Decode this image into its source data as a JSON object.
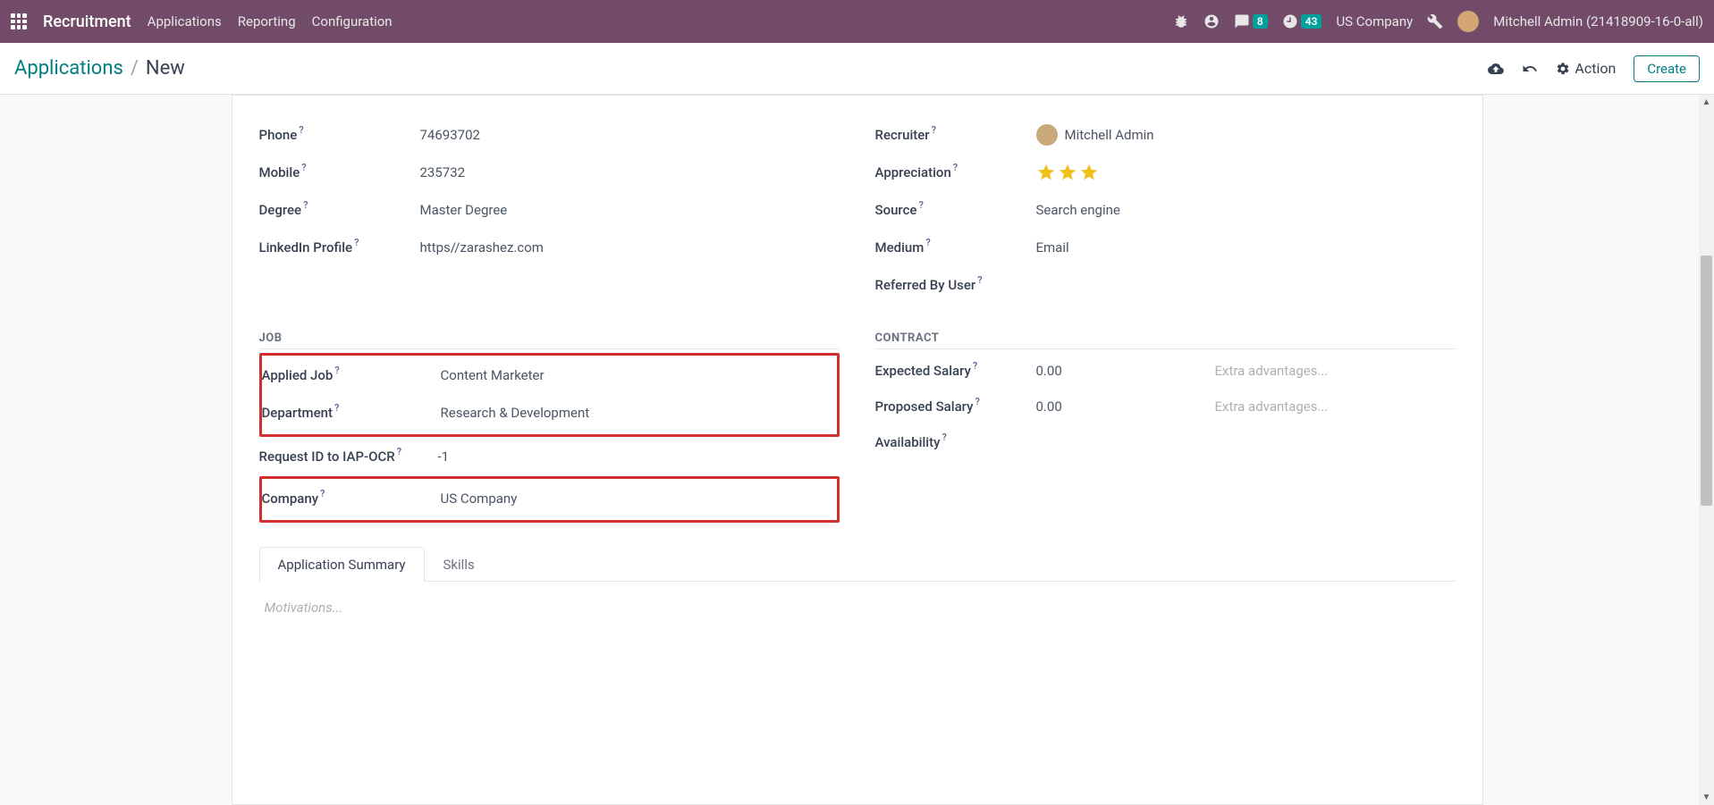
{
  "navbar": {
    "brand": "Recruitment",
    "menus": [
      "Applications",
      "Reporting",
      "Configuration"
    ],
    "messages_badge": "8",
    "activities_badge": "43",
    "company": "US Company",
    "user": "Mitchell Admin (21418909-16-0-all)"
  },
  "control_panel": {
    "breadcrumb_link": "Applications",
    "breadcrumb_sep": "/",
    "breadcrumb_current": "New",
    "action_label": "Action",
    "create_label": "Create"
  },
  "form": {
    "left_top": {
      "phone_label": "Phone",
      "phone_value": "74693702",
      "mobile_label": "Mobile",
      "mobile_value": "235732",
      "degree_label": "Degree",
      "degree_value": "Master Degree",
      "linkedin_label": "LinkedIn Profile",
      "linkedin_value": "https//zarashez.com"
    },
    "right_top": {
      "recruiter_label": "Recruiter",
      "recruiter_value": "Mitchell Admin",
      "appreciation_label": "Appreciation",
      "source_label": "Source",
      "source_value": "Search engine",
      "medium_label": "Medium",
      "medium_value": "Email",
      "referred_label": "Referred By User"
    },
    "job_section": {
      "title": "JOB",
      "applied_job_label": "Applied Job",
      "applied_job_value": "Content Marketer",
      "department_label": "Department",
      "department_value": "Research & Development",
      "request_id_label": "Request ID to IAP-OCR",
      "request_id_value": "-1",
      "company_label": "Company",
      "company_value": "US Company"
    },
    "contract_section": {
      "title": "CONTRACT",
      "expected_salary_label": "Expected Salary",
      "expected_salary_value": "0.00",
      "proposed_salary_label": "Proposed Salary",
      "proposed_salary_value": "0.00",
      "availability_label": "Availability",
      "extra_advantages_placeholder": "Extra advantages..."
    },
    "tabs": {
      "summary": "Application Summary",
      "skills": "Skills"
    },
    "motivations_placeholder": "Motivations...",
    "help": "?"
  }
}
